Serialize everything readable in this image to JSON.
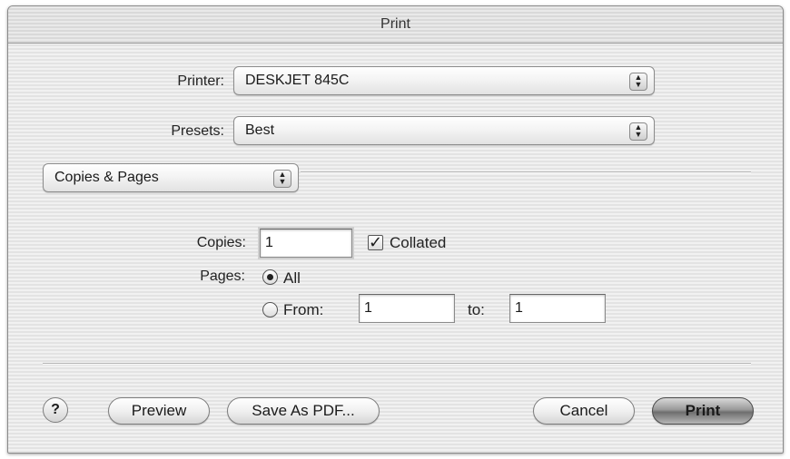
{
  "window": {
    "title": "Print"
  },
  "printer": {
    "label": "Printer:",
    "value": "DESKJET 845C"
  },
  "presets": {
    "label": "Presets:",
    "value": "Best"
  },
  "panel": {
    "value": "Copies & Pages"
  },
  "copies": {
    "label": "Copies:",
    "value": "1",
    "collated_label": "Collated",
    "collated_checked": true
  },
  "pages": {
    "label": "Pages:",
    "all_label": "All",
    "from_label": "From:",
    "from_value": "1",
    "to_label": "to:",
    "to_value": "1",
    "selected": "All"
  },
  "buttons": {
    "help": "?",
    "preview": "Preview",
    "save_pdf": "Save As PDF...",
    "cancel": "Cancel",
    "print": "Print"
  },
  "icons": {
    "popup_arrows": "updown-arrows-icon",
    "check": "checkmark-icon",
    "radio_selected": "radio-dot-icon"
  }
}
